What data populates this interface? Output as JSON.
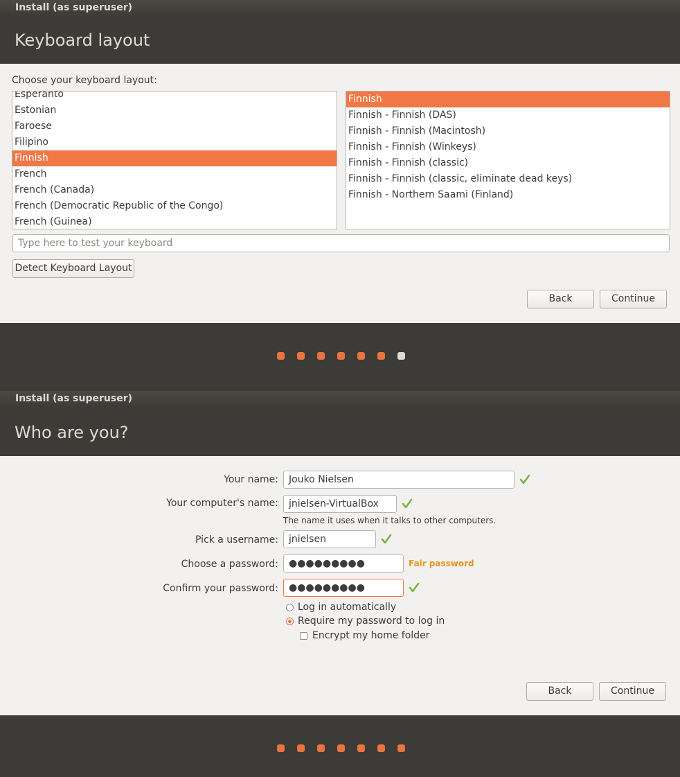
{
  "window1": {
    "title": "Install (as superuser)",
    "header": "Keyboard layout",
    "prompt": "Choose your keyboard layout:",
    "layouts": [
      "Esperanto",
      "Estonian",
      "Faroese",
      "Filipino",
      "Finnish",
      "French",
      "French (Canada)",
      "French (Democratic Republic of the Congo)",
      "French (Guinea)"
    ],
    "selected_layout_index": 4,
    "variants": [
      "Finnish",
      "Finnish - Finnish (DAS)",
      "Finnish - Finnish (Macintosh)",
      "Finnish - Finnish (Winkeys)",
      "Finnish - Finnish (classic)",
      "Finnish - Finnish (classic, eliminate dead keys)",
      "Finnish - Northern Saami (Finland)"
    ],
    "selected_variant_index": 0,
    "test_placeholder": "Type here to test your keyboard",
    "detect_button": "Detect Keyboard Layout",
    "back_button": "Back",
    "continue_button": "Continue",
    "progress": {
      "total": 7,
      "current": 7
    }
  },
  "window2": {
    "title": "Install (as superuser)",
    "header": "Who are you?",
    "name_label": "Your name:",
    "name_value": "Jouko Nielsen",
    "computer_label": "Your computer's name:",
    "computer_value": "jnielsen-VirtualBox",
    "computer_hint": "The name it uses when it talks to other computers.",
    "username_label": "Pick a username:",
    "username_value": "jnielsen",
    "password_label": "Choose a password:",
    "password_mask": "●●●●●●●●●",
    "password_strength": "Fair password",
    "confirm_label": "Confirm your password:",
    "confirm_mask": "●●●●●●●●●",
    "login_auto": "Log in automatically",
    "login_require": "Require my password to log in",
    "encrypt_home": "Encrypt my home folder",
    "back_button": "Back",
    "continue_button": "Continue",
    "progress": {
      "total": 7,
      "current": 8
    }
  },
  "colors": {
    "accent": "#f07746",
    "valid": "#7cb342",
    "warning": "#e8941a",
    "chrome": "#3c3b37"
  }
}
